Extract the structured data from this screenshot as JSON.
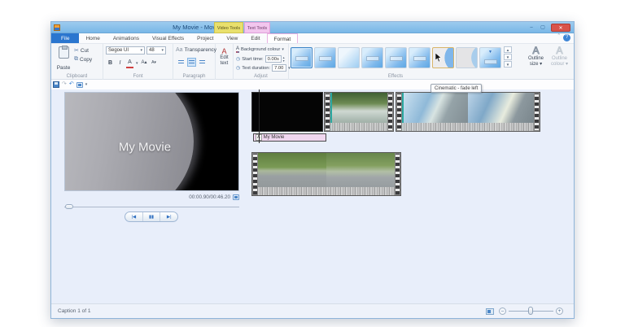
{
  "titlebar": {
    "title": "My Movie - Movie Maker",
    "video_tools_label": "Video Tools",
    "text_tools_label": "Text Tools",
    "controls": {
      "minimize": "–",
      "maximize": "▢",
      "close": "✕"
    }
  },
  "ribbon_chrome": {
    "collapse": "ˆ",
    "help": "?"
  },
  "tabs": [
    {
      "label": "File"
    },
    {
      "label": "Home"
    },
    {
      "label": "Animations"
    },
    {
      "label": "Visual Effects"
    },
    {
      "label": "Project"
    },
    {
      "label": "View"
    },
    {
      "label": "Edit"
    },
    {
      "label": "Format"
    }
  ],
  "clipboard": {
    "paste": "Paste",
    "cut": "Cut",
    "copy": "Copy",
    "label": "Clipboard"
  },
  "font": {
    "family": "Segoe UI",
    "size": "48",
    "bold": "B",
    "italic": "I",
    "color": "A",
    "grow": "A▴",
    "shrink": "A▾",
    "label": "Font"
  },
  "paragraph": {
    "transparency_icon": "Aa",
    "transparency": "Transparency",
    "label": "Paragraph"
  },
  "edit_text": {
    "icon": "A",
    "line1": "Edit",
    "line2": "text"
  },
  "adjust": {
    "background_icon": "A",
    "background_label": "Background colour",
    "start_time_label": "Start time:",
    "start_time_value": "0.00s",
    "duration_label": "Text duration:",
    "duration_value": "7.00",
    "label": "Adjust"
  },
  "effects": {
    "label": "Effects",
    "tooltip": "Cinematic - fade left"
  },
  "outline": {
    "size_icon": "A",
    "size_line1": "Outline",
    "size_line2": "size ▾",
    "colour_icon": "A",
    "colour_line1": "Outline",
    "colour_line2": "colour ▾"
  },
  "icons": {
    "clock": "◷",
    "dropdown": "▾",
    "spin_up": "▴",
    "spin_down": "▾",
    "undo": "↶",
    "redo": "↷",
    "cut": "✂",
    "copy": "⧉",
    "edit_pencil": "✎",
    "gallery_up": "▲",
    "gallery_down": "▼",
    "gallery_more": "▼"
  },
  "preview": {
    "overlay_text": "My Movie",
    "timecode": "00:00.90/00:46.20"
  },
  "playback": {
    "prev": "|◀",
    "pause": "▮▮",
    "next": "▶|"
  },
  "timeline": {
    "caption_icon": "A",
    "caption_text": "My Movie"
  },
  "statusbar": {
    "caption": "Caption 1 of 1",
    "zoom_out": "–",
    "zoom_in": "+"
  }
}
